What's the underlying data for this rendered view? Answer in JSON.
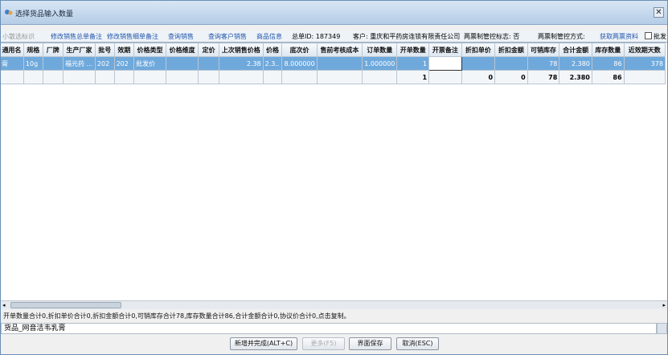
{
  "window": {
    "title": "选择货品输入数量",
    "close_label": "✕"
  },
  "toolbar": {
    "disabled_label": "小散选标识",
    "links": [
      "修改销售总单备注",
      "修改销售细单备注",
      "查询销售",
      "查询客户销售",
      "商品信息"
    ],
    "order_id": "总单ID: 187349",
    "customer": "客户: 重庆和平药房连锁有限责任公司",
    "invoice_flag": "两票制管控标志: 否",
    "invoice_mode": "两票制管控方式:",
    "get_invoice": "获取两票资料",
    "batch_label": "批发"
  },
  "grid": {
    "columns": [
      "通用名",
      "规格",
      "厂牌",
      "生产厂家",
      "批号",
      "效期",
      "价格类型",
      "价格维度",
      "定价",
      "上次销售价格",
      "价格",
      "底次价",
      "售前考核成本",
      "订单数量",
      "开单数量",
      "开票备注",
      "折扣单价",
      "折扣金额",
      "可销库存",
      "合计金额",
      "库存数量",
      "近效期天数"
    ],
    "rows": [
      [
        "膏",
        "10g",
        "",
        "福元药 ...",
        "202",
        "202",
        "批发价",
        "",
        "",
        "2.38",
        "2.3..",
        "8.000000",
        "",
        "1.000000",
        "1",
        "",
        "",
        "",
        "78",
        "2.380",
        "86",
        "378"
      ]
    ],
    "summary": [
      "",
      "",
      "",
      "",
      "",
      "",
      "",
      "",
      "",
      "",
      "",
      "",
      "",
      "",
      "1",
      "",
      "0",
      "0",
      "78",
      "2.380",
      "86",
      ""
    ]
  },
  "status_text": "开单数量合计0,折扣单价合计0,折扣金额合计0,可销库存合计78,库存数量合计86,合计金额合计0,协议价合计0,点击复制。",
  "goods_text": "货品_网音洁韦乳膏",
  "buttons": {
    "add_complete": "新增并完成(ALT+C)",
    "more": "更多(F5)",
    "save_layout": "界面保存",
    "cancel": "取消(ESC)"
  }
}
